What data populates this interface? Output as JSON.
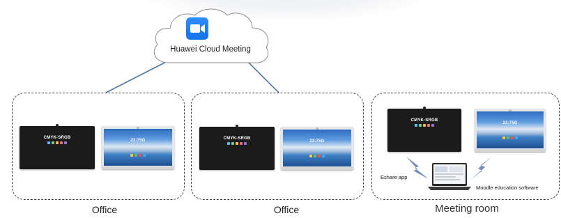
{
  "cloud": {
    "label": "Huawei Cloud Meeting",
    "icon": "video-camera-icon",
    "icon_color": "#2d8cff"
  },
  "sites": [
    {
      "caption": "Office",
      "screens": [
        {
          "style": "orange",
          "text": "CMYK-SRGB"
        },
        {
          "style": "white",
          "text": "23:75G"
        }
      ]
    },
    {
      "caption": "Office",
      "screens": [
        {
          "style": "orange",
          "text": "CMYK-SRGB"
        },
        {
          "style": "white",
          "text": "23:75G"
        }
      ]
    },
    {
      "caption": "Meeting room",
      "screens": [
        {
          "style": "orange",
          "text": "CMYK-SRGB"
        },
        {
          "style": "white",
          "text": "23:75G"
        }
      ],
      "eshare_label": "Eshare app",
      "moodle_label": "Moodle education software"
    }
  ],
  "colors": {
    "link_line": "#4f74a8",
    "bolt": "#6f8fb7",
    "border": "#444444"
  }
}
